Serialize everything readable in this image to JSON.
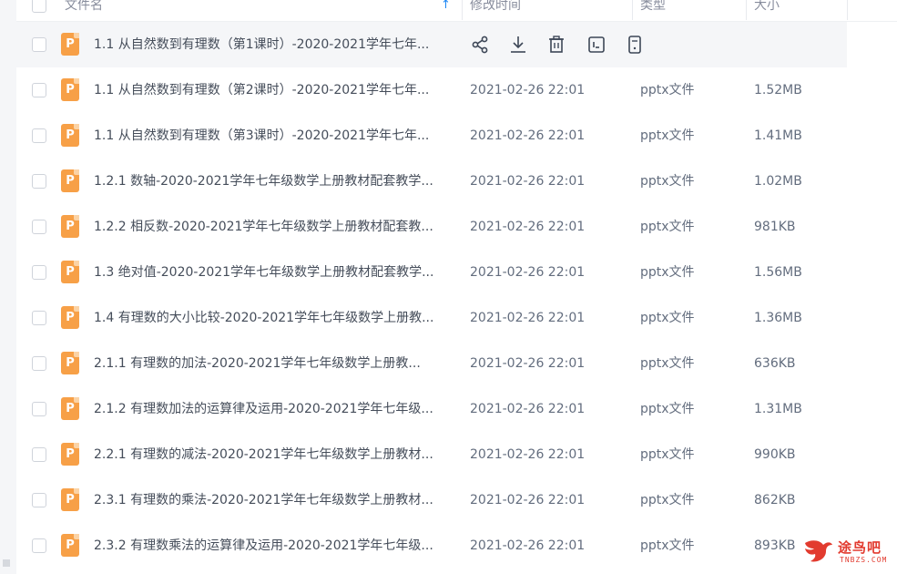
{
  "header": {
    "name_label": "文件名",
    "sort_icon": "arrow-up-icon",
    "time_label": "修改时间",
    "type_label": "类型",
    "size_label": "大小"
  },
  "hover_actions": [
    "share-icon",
    "download-icon",
    "delete-icon",
    "rename-icon",
    "more-icon"
  ],
  "files": [
    {
      "name": "1.1 从自然数到有理数（第1课时）-2020-2021学年七年...",
      "time": "",
      "type": "",
      "size": "",
      "hovered": true
    },
    {
      "name": "1.1 从自然数到有理数（第2课时）-2020-2021学年七年...",
      "time": "2021-02-26 22:01",
      "type": "pptx文件",
      "size": "1.52MB"
    },
    {
      "name": "1.1 从自然数到有理数（第3课时）-2020-2021学年七年...",
      "time": "2021-02-26 22:01",
      "type": "pptx文件",
      "size": "1.41MB"
    },
    {
      "name": "1.2.1 数轴-2020-2021学年七年级数学上册教材配套教学...",
      "time": "2021-02-26 22:01",
      "type": "pptx文件",
      "size": "1.02MB"
    },
    {
      "name": "1.2.2 相反数-2020-2021学年七年级数学上册教材配套教...",
      "time": "2021-02-26 22:01",
      "type": "pptx文件",
      "size": "981KB"
    },
    {
      "name": "1.3 绝对值-2020-2021学年七年级数学上册教材配套教学...",
      "time": "2021-02-26 22:01",
      "type": "pptx文件",
      "size": "1.56MB"
    },
    {
      "name": "1.4 有理数的大小比较-2020-2021学年七年级数学上册教...",
      "time": "2021-02-26 22:01",
      "type": "pptx文件",
      "size": "1.36MB"
    },
    {
      "name": "2.1.1  有理数的加法-2020-2021学年七年级数学上册教...",
      "time": "2021-02-26 22:01",
      "type": "pptx文件",
      "size": "636KB"
    },
    {
      "name": "2.1.2 有理数加法的运算律及运用-2020-2021学年七年级...",
      "time": "2021-02-26 22:01",
      "type": "pptx文件",
      "size": "1.31MB"
    },
    {
      "name": "2.2.1 有理数的减法-2020-2021学年七年级数学上册教材...",
      "time": "2021-02-26 22:01",
      "type": "pptx文件",
      "size": "990KB"
    },
    {
      "name": "2.3.1 有理数的乘法-2020-2021学年七年级数学上册教材...",
      "time": "2021-02-26 22:01",
      "type": "pptx文件",
      "size": "862KB"
    },
    {
      "name": "2.3.2 有理数乘法的运算律及运用-2020-2021学年七年级...",
      "time": "2021-02-26 22:01",
      "type": "pptx文件",
      "size": "893KB"
    }
  ],
  "file_icon_letter": "P",
  "watermark": {
    "text": "途鸟吧",
    "sub": "TNBZS.COM"
  },
  "colors": {
    "file_icon": "#f7a047",
    "accent": "#1e88f5",
    "watermark": "#e23b2f"
  }
}
